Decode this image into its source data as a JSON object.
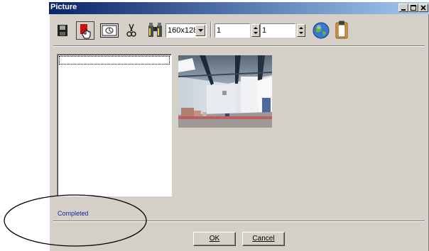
{
  "window": {
    "title": "Picture",
    "controls": [
      "minimize-icon",
      "maximize-icon",
      "close-icon"
    ]
  },
  "toolbar": {
    "icons": [
      "save-icon",
      "capture-icon",
      "camera-view-icon",
      "cut-icon",
      "binoculars-icon"
    ],
    "resolution": {
      "selected": "160x128"
    },
    "field_a": {
      "value": "1"
    },
    "field_b": {
      "value": "1"
    },
    "extra_icons": [
      "globe-icon",
      "clipboard-icon"
    ]
  },
  "status": {
    "text": "Completed"
  },
  "buttons": {
    "ok": "OK",
    "cancel": "Cancel"
  },
  "colors": {
    "title_bar_start": "#0a246a",
    "title_bar_end": "#a6caf0",
    "dialog_bg": "#d4d0c8",
    "status_text": "#1a1aa8"
  }
}
